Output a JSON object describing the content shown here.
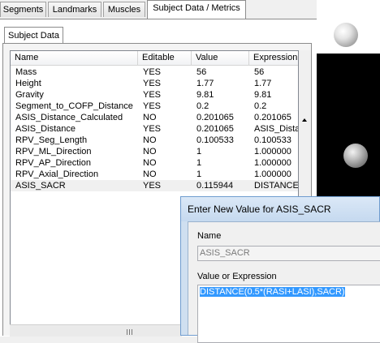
{
  "tabs": [
    {
      "label": "Segments"
    },
    {
      "label": "Landmarks"
    },
    {
      "label": "Muscles"
    },
    {
      "label": "Subject Data / Metrics"
    }
  ],
  "subtab": {
    "label": "Subject Data"
  },
  "table": {
    "columns": [
      "Name",
      "Editable",
      "Value",
      "Expression"
    ],
    "rows": [
      {
        "name": "Mass",
        "editable": "YES",
        "value": "56",
        "expression": "56"
      },
      {
        "name": "Height",
        "editable": "YES",
        "value": "1.77",
        "expression": "1.77"
      },
      {
        "name": "Gravity",
        "editable": "YES",
        "value": "9.81",
        "expression": "9.81"
      },
      {
        "name": "Segment_to_COFP_Distance",
        "editable": "YES",
        "value": "0.2",
        "expression": "0.2"
      },
      {
        "name": "ASIS_Distance_Calculated",
        "editable": "NO",
        "value": "0.201065",
        "expression": "0.201065"
      },
      {
        "name": "ASIS_Distance",
        "editable": "YES",
        "value": "0.201065",
        "expression": "ASIS_Distar"
      },
      {
        "name": "RPV_Seg_Length",
        "editable": "NO",
        "value": "0.100533",
        "expression": "0.100533"
      },
      {
        "name": "RPV_ML_Direction",
        "editable": "NO",
        "value": "1",
        "expression": "1.000000"
      },
      {
        "name": "RPV_AP_Direction",
        "editable": "NO",
        "value": "1",
        "expression": "1.000000"
      },
      {
        "name": "RPV_Axial_Direction",
        "editable": "NO",
        "value": "1",
        "expression": "1.000000"
      },
      {
        "name": "ASIS_SACR",
        "editable": "YES",
        "value": "0.115944",
        "expression": "DISTANCE("
      }
    ]
  },
  "dialog": {
    "title": "Enter New Value for ASIS_SACR",
    "name_label": "Name",
    "name_value": "ASIS_SACR",
    "expr_label": "Value or Expression",
    "expr_value": "DISTANCE(0.5*(RASI+LASI),SACR)"
  }
}
